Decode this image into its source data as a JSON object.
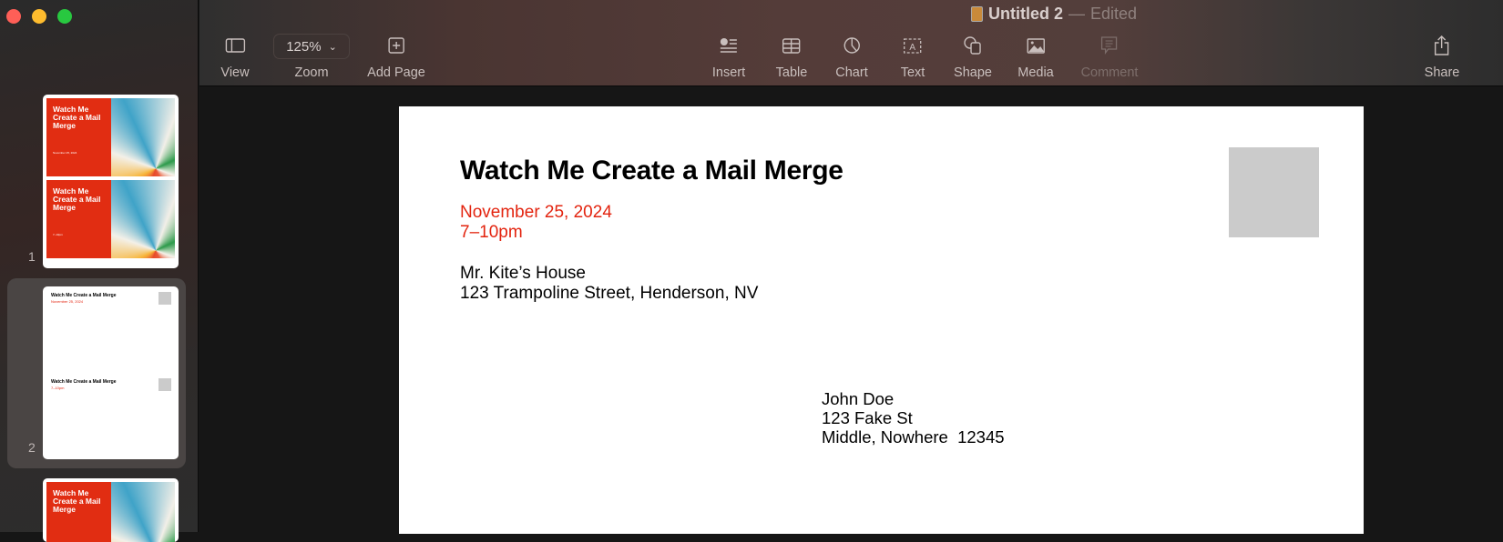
{
  "window": {
    "title": "Untitled 2",
    "separator": "—",
    "status": "Edited"
  },
  "toolbar": {
    "view": "View",
    "zoom_value": "125%",
    "zoom": "Zoom",
    "add_page": "Add Page",
    "insert": "Insert",
    "table": "Table",
    "chart": "Chart",
    "text": "Text",
    "shape": "Shape",
    "media": "Media",
    "comment": "Comment",
    "share": "Share"
  },
  "sidebar": {
    "pages": [
      {
        "number": "1",
        "card_title": "Watch Me Create a Mail Merge",
        "card_lines": [
          "November 25, 2024",
          "7–10pm"
        ]
      },
      {
        "number": "2",
        "title": "Watch Me Create a Mail Merge",
        "date": "November 25, 2024",
        "time": "7–10pm"
      },
      {
        "card_title": "Watch Me Create a Mail Merge"
      }
    ]
  },
  "document": {
    "title": "Watch Me Create a Mail Merge",
    "date": "November 25, 2024",
    "time": "7–10pm",
    "sender_name": "Mr. Kite’s House",
    "sender_address": "123 Trampoline Street, Henderson, NV",
    "recipient": [
      "John Doe",
      "123 Fake St",
      "Middle, Nowhere  12345"
    ]
  },
  "colors": {
    "accent_red": "#e3240f",
    "stamp": "#cbcbcb"
  }
}
